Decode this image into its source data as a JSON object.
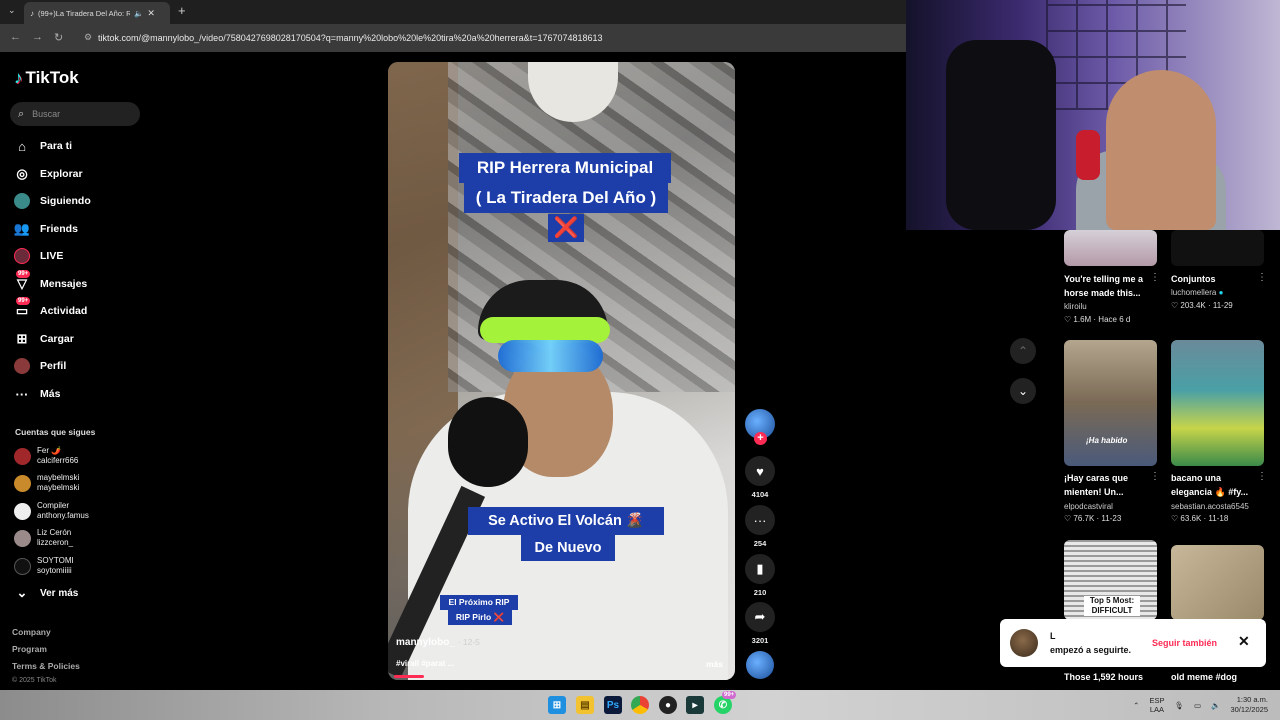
{
  "browser": {
    "tab_title": "(99+)La Tiradera Del Año: R",
    "url": "tiktok.com/@mannylobo_/video/7580427698028170504?q=manny%20lobo%20le%20tira%20a%20herrera&t=1767074818613"
  },
  "brand": {
    "name": "TikTok"
  },
  "search": {
    "placeholder": "Buscar"
  },
  "nav": [
    {
      "label": "Para ti",
      "icon": "home-icon"
    },
    {
      "label": "Explorar",
      "icon": "compass-icon"
    },
    {
      "label": "Siguiendo",
      "icon": "following-avatar-icon"
    },
    {
      "label": "Friends",
      "icon": "friends-icon"
    },
    {
      "label": "LIVE",
      "icon": "live-icon"
    },
    {
      "label": "Mensajes",
      "icon": "messages-icon",
      "badge": "99+"
    },
    {
      "label": "Actividad",
      "icon": "activity-icon",
      "badge": "99+"
    },
    {
      "label": "Cargar",
      "icon": "upload-icon"
    },
    {
      "label": "Perfil",
      "icon": "profile-icon"
    },
    {
      "label": "Más",
      "icon": "more-icon"
    }
  ],
  "following": {
    "title": "Cuentas que sigues",
    "accounts": [
      {
        "name": "Fer 🌶️",
        "handle": "calciferr666"
      },
      {
        "name": "maybelmski",
        "handle": "maybelmski"
      },
      {
        "name": "Compiler",
        "handle": "anthony.famus"
      },
      {
        "name": "Liz Cerón",
        "handle": "lizzceron_"
      },
      {
        "name": "SOYTOMI",
        "handle": "soytomiiiii"
      }
    ],
    "see_more": "Ver más"
  },
  "footer": {
    "links": [
      "Company",
      "Program",
      "Terms & Policies"
    ],
    "copyright": "© 2025 TikTok"
  },
  "video": {
    "caption_line1": "RIP Herrera Municipal",
    "caption_line2": "( La Tiradera Del Año )",
    "caption_x": "❌",
    "caption_line3": "Se Activo El Volcán 🌋",
    "caption_line4": "De Nuevo",
    "caption_line5": "El Próximo RIP",
    "caption_line6": "RIP Pirlo ❌",
    "author": "mannylobo_",
    "date": "· 12-5",
    "tags": "#virall #parat ...",
    "more": "más",
    "progress": 0.09
  },
  "actions": {
    "likes": "4104",
    "comments": "254",
    "saves": "210",
    "shares": "3201"
  },
  "recommendations": [
    {
      "title": "You're telling me a horse made this...",
      "author": "kliroilu",
      "stats": "♡ 1.6M · Hace 6 d"
    },
    {
      "title": "Conjuntos",
      "author": "luchomellera",
      "verified": true,
      "stats": "♡ 203.4K · 11-29"
    },
    {
      "title": "¡Hay caras que mienten! Un...",
      "author": "elpodcastviral",
      "stats": "♡ 76.7K · 11-23",
      "overlay": "¡Ha habido"
    },
    {
      "title": "bacano una elegancia 🔥 #fy...",
      "author": "sebastian.acosta6545",
      "stats": "♡ 63.6K · 11-18"
    },
    {
      "title": "Those 1,592 hours",
      "author": "",
      "stats": "",
      "overlay": "Top 5 Most: DIFFICULT"
    },
    {
      "title": "old meme #dog",
      "author": "",
      "stats": ""
    }
  ],
  "toast": {
    "name": "L",
    "message": "empezó a seguirte.",
    "follow_back": "Seguir también",
    "close": "✕"
  },
  "taskbar": {
    "lang": "ESP",
    "region": "LAA",
    "time": "1:30 a.m.",
    "date": "30/12/2025",
    "whatsapp_badge": "99+"
  },
  "colors": {
    "accent": "#fe2c55",
    "caption_bg": "#1d3ea8"
  }
}
